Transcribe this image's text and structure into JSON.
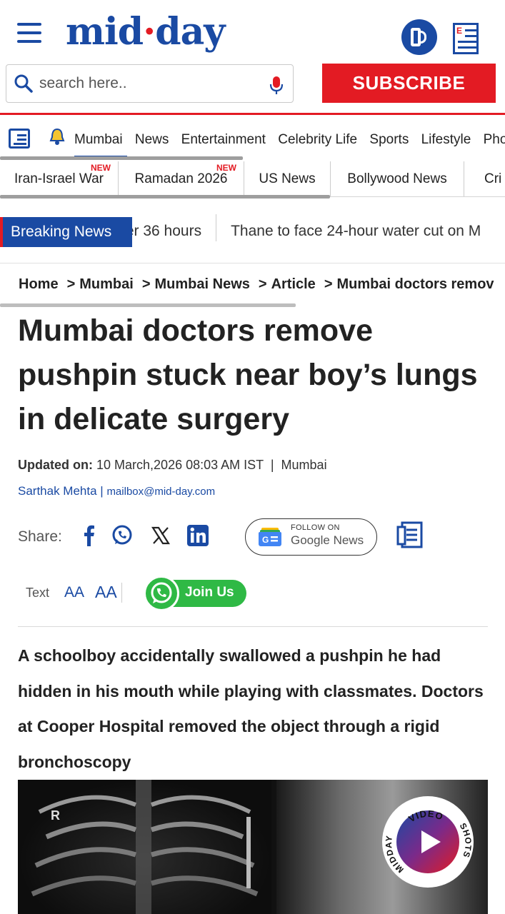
{
  "header": {
    "logo_main": "mid",
    "logo_dot": "·",
    "logo_end": "day",
    "search_placeholder": "search here..",
    "subscribe_label": "SUBSCRIBE",
    "epaper_letter": "E"
  },
  "category_nav": {
    "items": [
      "Mumbai",
      "News",
      "Entertainment",
      "Celebrity Life",
      "Sports",
      "Lifestyle",
      "Pho"
    ],
    "active": "Mumbai"
  },
  "trending_tags": [
    {
      "label": "Iran-Israel War",
      "badge": "NEW"
    },
    {
      "label": "Ramadan 2026",
      "badge": "NEW"
    },
    {
      "label": "US News",
      "badge": ""
    },
    {
      "label": "Bollywood News",
      "badge": ""
    },
    {
      "label": "Cri",
      "badge": ""
    }
  ],
  "breaking": {
    "label": "Breaking News",
    "items": [
      "ter 36 hours",
      "Thane to face 24-hour water cut on M"
    ]
  },
  "breadcrumb": [
    "Home",
    "Mumbai",
    "Mumbai News",
    "Article",
    "Mumbai doctors remov"
  ],
  "article": {
    "headline": "Mumbai doctors remove pushpin stuck near boy’s lungs in delicate surgery",
    "updated_label": "Updated on:",
    "updated_value": "10 March,2026 08:03 AM IST",
    "location": "Mumbai",
    "author": "Sarthak Mehta",
    "author_email": "mailbox@mid-day.com",
    "summary": "A schoolboy accidentally swallowed a pushpin he had hidden in his mouth while playing with classmates. Doctors at Cooper Hospital removed the object through a rigid bronchoscopy"
  },
  "share": {
    "label": "Share:",
    "icons": [
      "facebook-icon",
      "whatsapp-icon",
      "x-icon",
      "linkedin-icon"
    ],
    "google_follow": "FOLLOW ON",
    "google_name": "Google",
    "google_news": "News"
  },
  "text_size": {
    "label": "Text",
    "small": "AA",
    "large": "AA",
    "join_label": "Join Us"
  },
  "hero": {
    "xray_marker": "R",
    "badge_top": "VIDEO",
    "badge_left": "MIDDAY",
    "badge_right": "SHOTS"
  },
  "colors": {
    "brand_blue": "#1a4aa3",
    "brand_red": "#e31b23",
    "whatsapp_green": "#2fb945"
  }
}
